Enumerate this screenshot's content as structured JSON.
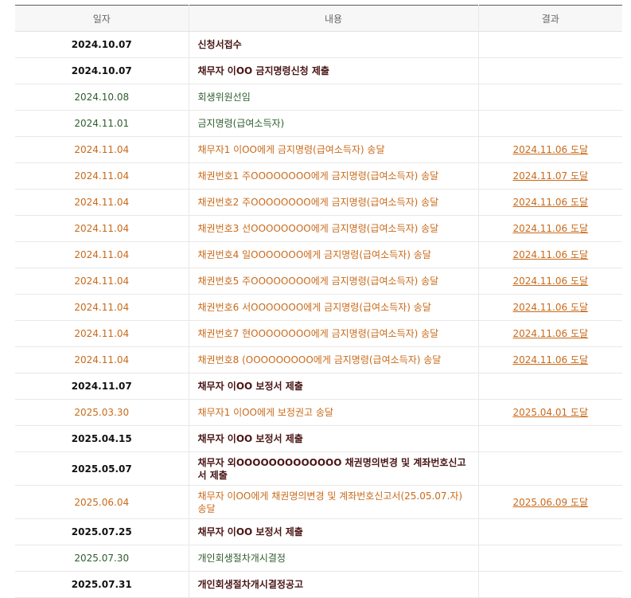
{
  "headers": {
    "date": "일자",
    "content": "내용",
    "result": "결과"
  },
  "rows": [
    {
      "type": "dark",
      "date": "2024.10.07",
      "content": "신청서접수",
      "result": ""
    },
    {
      "type": "dark",
      "date": "2024.10.07",
      "content": "채무자 이OO 금지명령신청 제출",
      "result": ""
    },
    {
      "type": "green",
      "date": "2024.10.08",
      "content": "회생위원선임",
      "result": ""
    },
    {
      "type": "green",
      "date": "2024.11.01",
      "content": "금지명령(급여소득자)",
      "result": ""
    },
    {
      "type": "orange",
      "date": "2024.11.04",
      "content": "채무자1 이OO에게 금지명령(급여소득자) 송달",
      "result": "2024.11.06 도달"
    },
    {
      "type": "orange",
      "date": "2024.11.04",
      "content": "채권번호1 주OOOOOOOO에게 금지명령(급여소득자) 송달",
      "result": "2024.11.07 도달"
    },
    {
      "type": "orange",
      "date": "2024.11.04",
      "content": "채권번호2 주OOOOOOOO에게 금지명령(급여소득자) 송달",
      "result": "2024.11.06 도달"
    },
    {
      "type": "orange",
      "date": "2024.11.04",
      "content": "채권번호3 선OOOOOOOO에게 금지명령(급여소득자) 송달",
      "result": "2024.11.06 도달"
    },
    {
      "type": "orange",
      "date": "2024.11.04",
      "content": "채권번호4 일OOOOOOO에게 금지명령(급여소득자) 송달",
      "result": "2024.11.06 도달"
    },
    {
      "type": "orange",
      "date": "2024.11.04",
      "content": "채권번호5 주OOOOOOOO에게 금지명령(급여소득자) 송달",
      "result": "2024.11.06 도달"
    },
    {
      "type": "orange",
      "date": "2024.11.04",
      "content": "채권번호6 서OOOOOOO에게 금지명령(급여소득자) 송달",
      "result": "2024.11.06 도달"
    },
    {
      "type": "orange",
      "date": "2024.11.04",
      "content": "채권번호7 현OOOOOOOO에게 금지명령(급여소득자) 송달",
      "result": "2024.11.06 도달"
    },
    {
      "type": "orange",
      "date": "2024.11.04",
      "content": "채권번호8 (OOOOOOOOO에게 금지명령(급여소득자) 송달",
      "result": "2024.11.06 도달"
    },
    {
      "type": "dark",
      "date": "2024.11.07",
      "content": "채무자 이OO 보정서 제출",
      "result": ""
    },
    {
      "type": "orange",
      "date": "2025.03.30",
      "content": "채무자1 이OO에게 보정권고 송달",
      "result": "2025.04.01 도달"
    },
    {
      "type": "dark",
      "date": "2025.04.15",
      "content": "채무자 이OO 보정서 제출",
      "result": ""
    },
    {
      "type": "dark",
      "date": "2025.05.07",
      "content": "채무자 외OOOOOOOOOOOOO 채권명의변경 및 계좌번호신고서 제출",
      "result": "",
      "tall": true
    },
    {
      "type": "orange",
      "date": "2025.06.04",
      "content": "채무자 이OO에게 채권명의변경 및 계좌번호신고서(25.05.07.자) 송달",
      "result": "2025.06.09 도달",
      "tall": true
    },
    {
      "type": "dark",
      "date": "2025.07.25",
      "content": "채무자 이OO 보정서 제출",
      "result": ""
    },
    {
      "type": "green",
      "date": "2025.07.30",
      "content": "개인회생절차개시결정",
      "result": ""
    },
    {
      "type": "dark",
      "date": "2025.07.31",
      "content": "개인회생절차개시결정공고",
      "result": ""
    }
  ]
}
